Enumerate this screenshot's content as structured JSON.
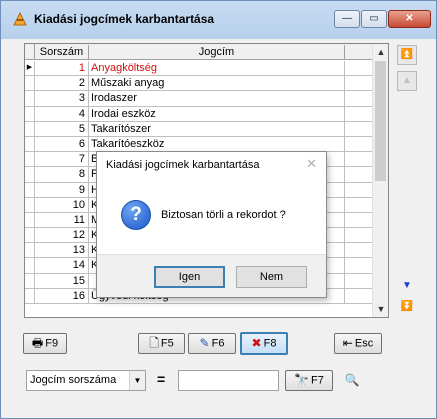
{
  "window": {
    "title": "Kiadási jogcímek karbantartása",
    "min_glyph": "—",
    "max_glyph": "▭",
    "close_glyph": "✕"
  },
  "grid": {
    "columns": [
      "Sorszám",
      "Jogcím",
      ""
    ],
    "rows": [
      {
        "num": "1",
        "name": "Anyagköltség",
        "selected": true
      },
      {
        "num": "2",
        "name": "Műszaki anyag"
      },
      {
        "num": "3",
        "name": "Irodaszer"
      },
      {
        "num": "4",
        "name": "Irodai eszköz"
      },
      {
        "num": "5",
        "name": "Takarítószer"
      },
      {
        "num": "6",
        "name": "Takarítóeszköz"
      },
      {
        "num": "7",
        "name": "Ba"
      },
      {
        "num": "8",
        "name": "Po"
      },
      {
        "num": "9",
        "name": "Hi"
      },
      {
        "num": "10",
        "name": "Kö"
      },
      {
        "num": "11",
        "name": "Mű"
      },
      {
        "num": "12",
        "name": "Kö"
      },
      {
        "num": "13",
        "name": "Kö"
      },
      {
        "num": "14",
        "name": "Kö"
      },
      {
        "num": "15",
        "name": ""
      },
      {
        "num": "16",
        "name": "Ügyvédi költség"
      }
    ],
    "current_row_marker": "▶"
  },
  "toolbar": {
    "print": "F9",
    "new": "F5",
    "edit": "F6",
    "delete": "F8",
    "exit": "Esc",
    "search": "F7"
  },
  "filter": {
    "field": "Jogcím sorszáma",
    "operator": "=",
    "value": ""
  },
  "dialog": {
    "title": "Kiadási jogcímek karbantartása",
    "message": "Biztosan törli a rekordot ?",
    "yes": "Igen",
    "no": "Nem",
    "icon": "question-icon"
  },
  "colors": {
    "selected_text": "#d01010",
    "nav_active": "#1a3fd0",
    "focus_border": "#3c7fb1"
  }
}
